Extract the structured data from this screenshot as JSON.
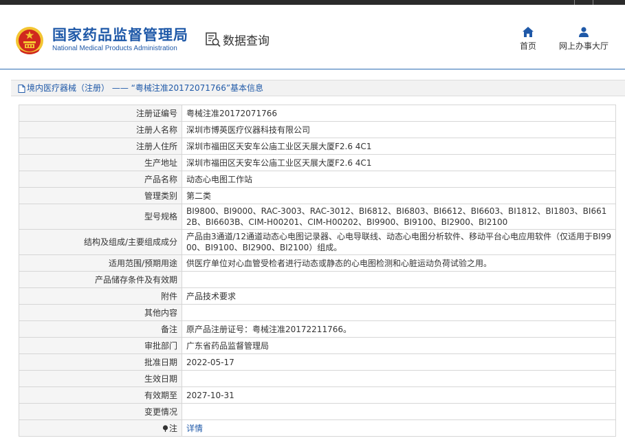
{
  "header": {
    "brand_cn": "国家药品监督管理局",
    "brand_en": "National Medical Products Administration",
    "query_label": "数据查询",
    "query_icon": "data-search-icon",
    "nav": [
      {
        "label": "首页",
        "icon": "home-icon"
      },
      {
        "label": "网上办事大厅",
        "icon": "user-icon"
      }
    ]
  },
  "breadcrumb": {
    "icon": "document-icon",
    "text": "境内医疗器械（注册） —— “粤械注准20172071766”基本信息"
  },
  "colors": {
    "brand_blue": "#1f59a8",
    "label_bg": "#f5f5f5",
    "emblem_red": "#d0281e",
    "emblem_gold": "#f3c532"
  },
  "rows": [
    {
      "label": "注册证编号",
      "value": "粤械注准20172071766"
    },
    {
      "label": "注册人名称",
      "value": "深圳市博英医疗仪器科技有限公司"
    },
    {
      "label": "注册人住所",
      "value": "深圳市福田区天安车公庙工业区天展大厦F2.6 4C1"
    },
    {
      "label": "生产地址",
      "value": "深圳市福田区天安车公庙工业区天展大厦F2.6 4C1"
    },
    {
      "label": "产品名称",
      "value": "动态心电图工作站"
    },
    {
      "label": "管理类别",
      "value": "第二类"
    },
    {
      "label": "型号规格",
      "value": "BI9800、BI9000、RAC-3003、RAC-3012、BI6812、BI6803、BI6612、BI6603、BI1812、BI1803、BI6612B、BI6603B、CIM-H00201、CIM-H00202、BI9900、BI9100、BI2900、BI2100"
    },
    {
      "label": "结构及组成/主要组成成分",
      "value": "产品由3通道/12通道动态心电图记录器、心电导联线、动态心电图分析软件、移动平台心电应用软件（仅适用于BI9900、BI9100、BI2900、BI2100）组成。"
    },
    {
      "label": "适用范围/预期用途",
      "value": "供医疗单位对心血管受检者进行动态或静态的心电图检测和心脏运动负荷试验之用。"
    },
    {
      "label": "产品储存条件及有效期",
      "value": ""
    },
    {
      "label": "附件",
      "value": "产品技术要求"
    },
    {
      "label": "其他内容",
      "value": ""
    },
    {
      "label": "备注",
      "value": "原产品注册证号：粤械注准20172211766。"
    },
    {
      "label": "审批部门",
      "value": "广东省药品监督管理局"
    },
    {
      "label": "批准日期",
      "value": "2022-05-17"
    },
    {
      "label": "生效日期",
      "value": ""
    },
    {
      "label": "有效期至",
      "value": "2027-10-31"
    },
    {
      "label": "变更情况",
      "value": ""
    },
    {
      "label": "注",
      "value": "详情",
      "icon": "pin-icon"
    }
  ]
}
